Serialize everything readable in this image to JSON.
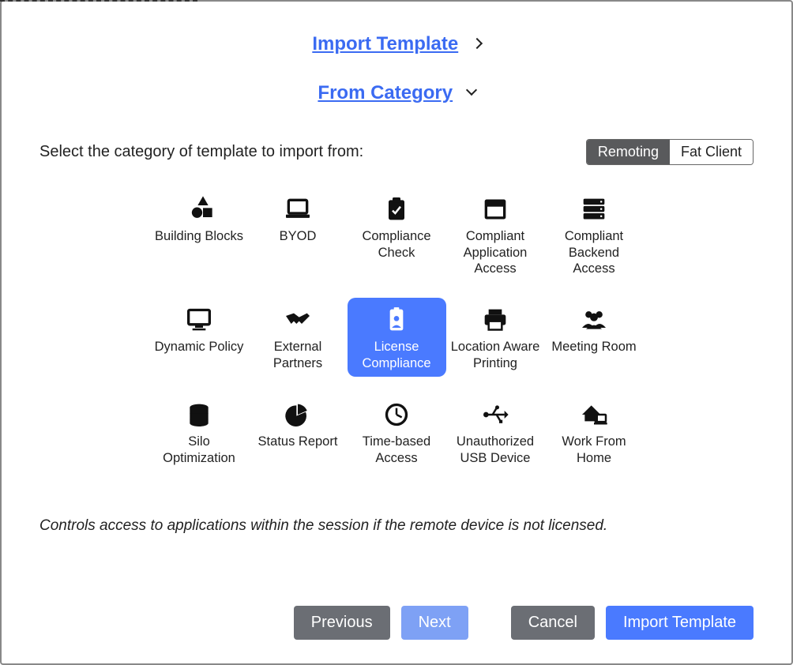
{
  "header": {
    "import_template": "Import Template",
    "from_category": "From Category"
  },
  "prompt": "Select the category of template to import from:",
  "toggle": {
    "remoting": "Remoting",
    "fat_client": "Fat Client",
    "active": "Remoting"
  },
  "categories": [
    {
      "label": "Building Blocks",
      "icon": "shapes-icon"
    },
    {
      "label": "BYOD",
      "icon": "laptop-icon"
    },
    {
      "label": "Compliance Check",
      "icon": "clipboard-check-icon"
    },
    {
      "label": "Compliant Application Access",
      "icon": "window-icon"
    },
    {
      "label": "Compliant Backend Access",
      "icon": "server-icon"
    },
    {
      "label": "Dynamic Policy",
      "icon": "monitor-icon"
    },
    {
      "label": "External Partners",
      "icon": "handshake-icon"
    },
    {
      "label": "License Compliance",
      "icon": "id-badge-icon",
      "selected": true
    },
    {
      "label": "Location Aware Printing",
      "icon": "printer-icon"
    },
    {
      "label": "Meeting Room",
      "icon": "people-icon"
    },
    {
      "label": "Silo Optimization",
      "icon": "database-icon"
    },
    {
      "label": "Status Report",
      "icon": "pie-chart-icon"
    },
    {
      "label": "Time-based Access",
      "icon": "clock-icon"
    },
    {
      "label": "Unauthorized USB Device",
      "icon": "usb-icon"
    },
    {
      "label": "Work From Home",
      "icon": "house-laptop-icon"
    }
  ],
  "description": "Controls access to applications within the session if the remote device is not licensed.",
  "buttons": {
    "previous": "Previous",
    "next": "Next",
    "cancel": "Cancel",
    "import": "Import Template"
  }
}
